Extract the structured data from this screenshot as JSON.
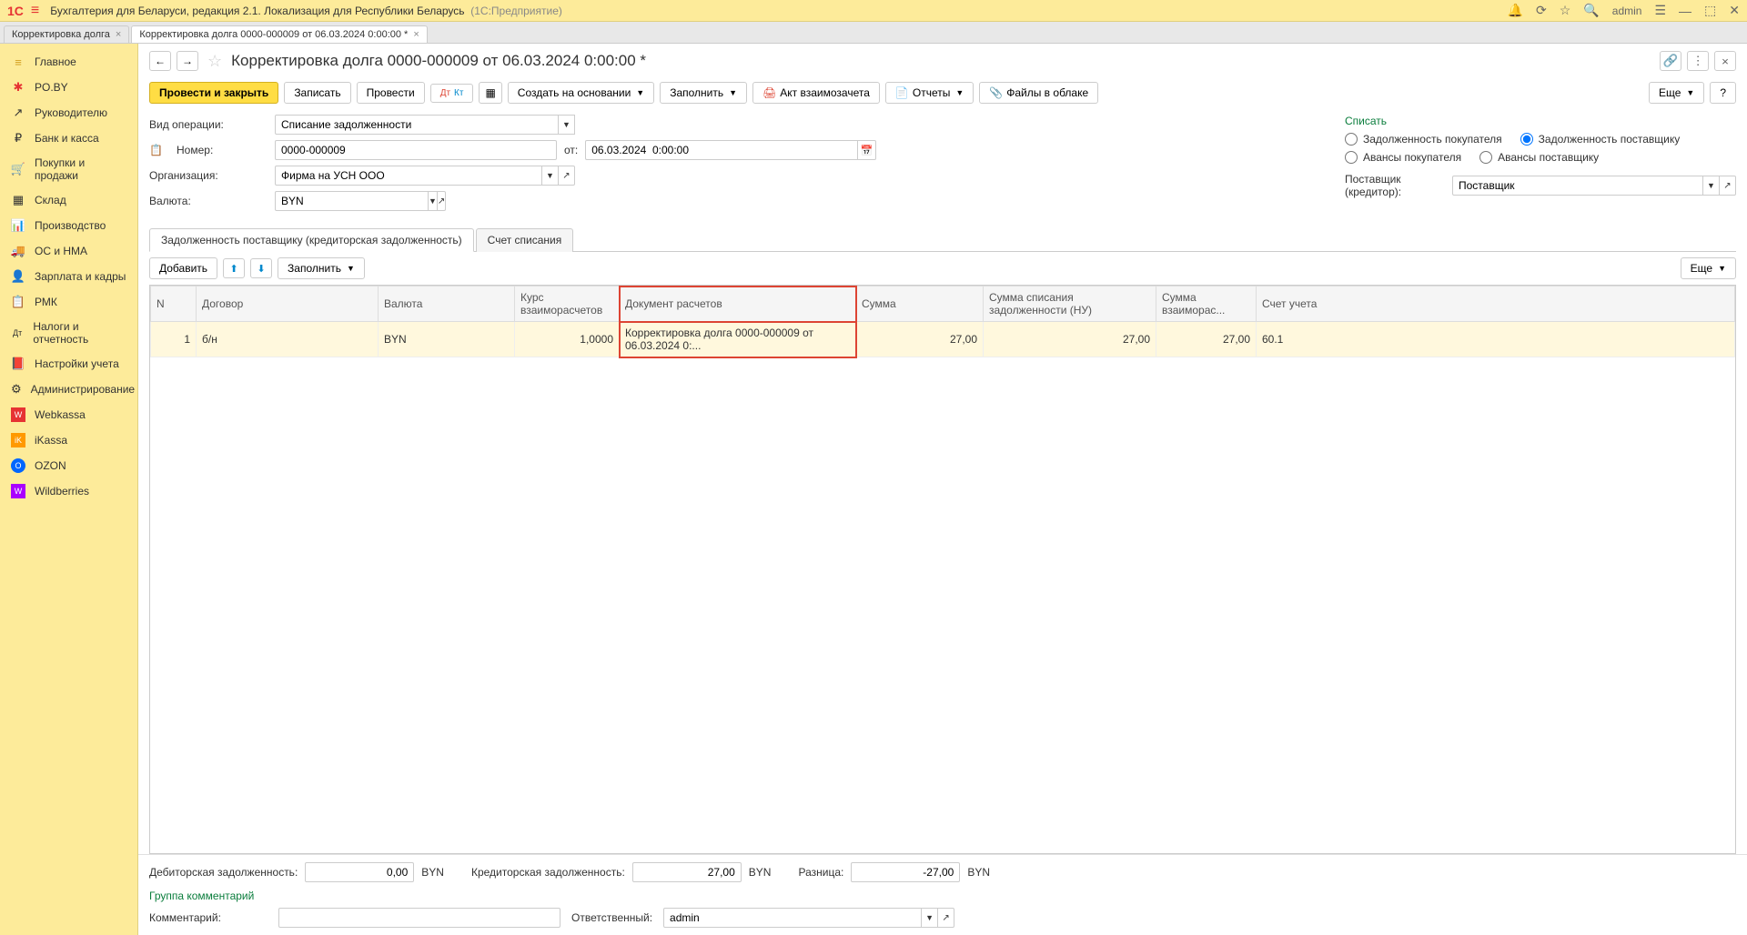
{
  "titlebar": {
    "logo": "1С",
    "title": "Бухгалтерия для Беларуси, редакция 2.1. Локализация для Республики Беларусь",
    "suffix": "(1С:Предприятие)",
    "user": "admin"
  },
  "tabs": [
    {
      "label": "Корректировка долга",
      "active": false
    },
    {
      "label": "Корректировка долга 0000-000009 от 06.03.2024 0:00:00 *",
      "active": true
    }
  ],
  "sidebar": [
    {
      "icon": "≡",
      "label": "Главное",
      "color": "#d4a020"
    },
    {
      "icon": "✱",
      "label": "PO.BY",
      "color": "#e63333"
    },
    {
      "icon": "↗",
      "label": "Руководителю",
      "color": "#666"
    },
    {
      "icon": "₽",
      "label": "Банк и касса",
      "color": "#666"
    },
    {
      "icon": "🛒",
      "label": "Покупки и продажи",
      "color": "#666"
    },
    {
      "icon": "▦",
      "label": "Склад",
      "color": "#666"
    },
    {
      "icon": "📊",
      "label": "Производство",
      "color": "#666"
    },
    {
      "icon": "🚚",
      "label": "ОС и НМА",
      "color": "#666"
    },
    {
      "icon": "👤",
      "label": "Зарплата и кадры",
      "color": "#666"
    },
    {
      "icon": "📋",
      "label": "РМК",
      "color": "#666"
    },
    {
      "icon": "Дт",
      "label": "Налоги и отчетность",
      "color": "#666"
    },
    {
      "icon": "📕",
      "label": "Настройки учета",
      "color": "#666"
    },
    {
      "icon": "⚙",
      "label": "Администрирование",
      "color": "#666"
    },
    {
      "icon": "W",
      "label": "Webkassa",
      "color": "#e63333"
    },
    {
      "icon": "iK",
      "label": "iKassa",
      "color": "#f90"
    },
    {
      "icon": "O",
      "label": "OZON",
      "color": "#0af"
    },
    {
      "icon": "W",
      "label": "Wildberries",
      "color": "#a0f"
    }
  ],
  "page": {
    "title": "Корректировка долга 0000-000009 от 06.03.2024 0:00:00 *"
  },
  "toolbar": {
    "post_close": "Провести и закрыть",
    "write": "Записать",
    "post": "Провести",
    "create_based": "Создать на основании",
    "fill": "Заполнить",
    "act": "Акт взаимозачета",
    "reports": "Отчеты",
    "files": "Файлы в облаке",
    "more": "Еще",
    "help": "?"
  },
  "form": {
    "operation_label": "Вид операции:",
    "operation_value": "Списание задолженности",
    "number_label": "Номер:",
    "number_value": "0000-000009",
    "date_label": "от:",
    "date_value": "06.03.2024  0:00:00",
    "org_label": "Организация:",
    "org_value": "Фирма на УСН ООО",
    "currency_label": "Валюта:",
    "currency_value": "BYN",
    "writeoff_title": "Списать",
    "radio1": "Задолженность покупателя",
    "radio2": "Задолженность поставщику",
    "radio3": "Авансы покупателя",
    "radio4": "Авансы поставщику",
    "supplier_label": "Поставщик (кредитор):",
    "supplier_value": "Поставщик"
  },
  "inner_tabs": {
    "tab1": "Задолженность поставщику (кредиторская задолженность)",
    "tab2": "Счет списания"
  },
  "table_toolbar": {
    "add": "Добавить",
    "fill": "Заполнить",
    "more": "Еще"
  },
  "table": {
    "headers": {
      "n": "N",
      "contract": "Договор",
      "currency": "Валюта",
      "rate": "Курс взаиморасчетов",
      "doc": "Документ расчетов",
      "sum": "Сумма",
      "sum_writeoff": "Сумма списания задолженности (НУ)",
      "sum_calc": "Сумма взаиморас...",
      "account": "Счет учета"
    },
    "row": {
      "n": "1",
      "contract": "б/н",
      "currency": "BYN",
      "rate": "1,0000",
      "doc": "Корректировка долга 0000-000009 от 06.03.2024 0:...",
      "sum": "27,00",
      "sum_writeoff": "27,00",
      "sum_calc": "27,00",
      "account": "60.1"
    }
  },
  "totals": {
    "debit_label": "Дебиторская задолженность:",
    "debit_value": "0,00",
    "debit_cur": "BYN",
    "credit_label": "Кредиторская задолженность:",
    "credit_value": "27,00",
    "credit_cur": "BYN",
    "diff_label": "Разница:",
    "diff_value": "-27,00",
    "diff_cur": "BYN"
  },
  "footer": {
    "comment_group": "Группа комментарий",
    "comment_label": "Комментарий:",
    "responsible_label": "Ответственный:",
    "responsible_value": "admin"
  }
}
